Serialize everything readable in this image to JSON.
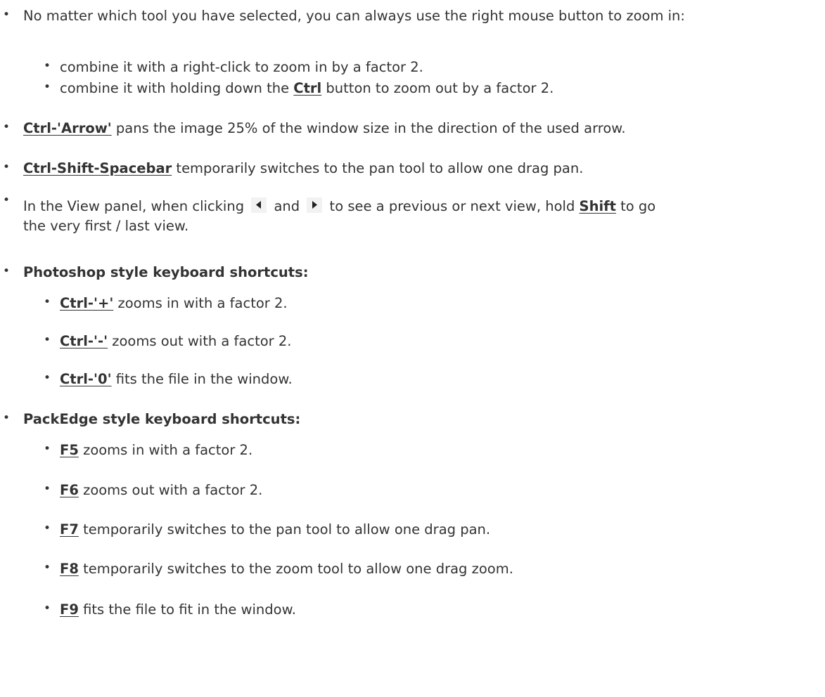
{
  "items": {
    "right_mouse": {
      "text": "No matter which tool you have selected, you can always use the right mouse button to zoom in:",
      "sub": [
        "combine it with a right-click to zoom in by a factor 2.",
        "combine it with holding down the ",
        "Ctrl",
        " button to zoom out by a factor 2."
      ]
    },
    "ctrl_arrow": {
      "key": "Ctrl-'Arrow'",
      "text": " pans the image 25% of the window size in the direction of the used arrow."
    },
    "ctrl_shift_space": {
      "key": "Ctrl-Shift-Spacebar",
      "text": " temporarily switches to the pan tool to allow one drag pan."
    },
    "view_panel": {
      "text_before": "In the View panel, when clicking ",
      "text_and": " and ",
      "text_after": " to see a previous or next view, hold ",
      "key": "Shift",
      "text_end": " to go the very first / last view.",
      "line2": "the very first / last view.",
      "line1_end": " to go"
    },
    "photoshop": {
      "heading": "Photoshop style keyboard shortcuts:",
      "entries": [
        {
          "key": "Ctrl-'+'",
          "text": " zooms in with a factor 2."
        },
        {
          "key": "Ctrl-'-'",
          "text": " zooms out with a factor 2."
        },
        {
          "key": "Ctrl-'0'",
          "text": " fits the file in the window."
        }
      ]
    },
    "packedge": {
      "heading": "PackEdge style keyboard shortcuts:",
      "entries": [
        {
          "key": "F5",
          "text": " zooms in with a factor 2."
        },
        {
          "key": "F6",
          "text": " zooms out with a factor 2."
        },
        {
          "key": "F7",
          "text": " temporarily switches to the pan tool to allow one drag pan."
        },
        {
          "key": "F8",
          "text": " temporarily switches to the zoom tool to allow one drag zoom."
        },
        {
          "key": "F9",
          "text": " fits the file to fit in the window."
        }
      ]
    }
  },
  "bullet": "•",
  "icons": {
    "previous": "triangle-left-icon",
    "next": "triangle-right-icon"
  }
}
